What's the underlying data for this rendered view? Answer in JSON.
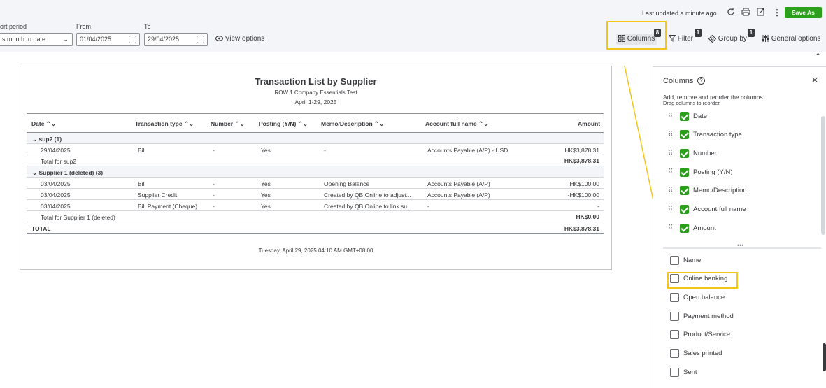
{
  "topbar": {
    "last_updated": "Last updated a minute ago",
    "save_as": "Save As",
    "report_period_label": "ort period",
    "report_period_value": "s month to date",
    "from_label": "From",
    "from_value": "01/04/2025",
    "to_label": "To",
    "to_value": "29/04/2025",
    "view_options": "View options",
    "columns_label": "Columns",
    "columns_count": "8",
    "filter_label": "Filter",
    "filter_count": "1",
    "group_by_label": "Group by",
    "group_by_count": "1",
    "general_options": "General options",
    "brand_color": "#2ca01c",
    "highlight_color": "#f5c518"
  },
  "report": {
    "title": "Transaction List by Supplier",
    "company": "ROW 1 Company Essentials Test",
    "period": "April 1-29, 2025",
    "columns": [
      "Date",
      "Transaction type",
      "Number",
      "Posting (Y/N)",
      "Memo/Description",
      "Account full name",
      "Amount"
    ],
    "groups": [
      {
        "name": "sup2 (1)",
        "rows": [
          [
            "29/04/2025",
            "Bill",
            "-",
            "Yes",
            "-",
            "Accounts Payable (A/P) - USD",
            "HK$3,878.31"
          ]
        ],
        "total_label": "Total for sup2",
        "total_value": "HK$3,878.31"
      },
      {
        "name": "Supplier 1 (deleted) (3)",
        "rows": [
          [
            "03/04/2025",
            "Bill",
            "-",
            "Yes",
            "Opening Balance",
            "Accounts Payable (A/P)",
            "HK$100.00"
          ],
          [
            "03/04/2025",
            "Supplier Credit",
            "-",
            "Yes",
            "Created by QB Online to adjust...",
            "Accounts Payable (A/P)",
            "-HK$100.00"
          ],
          [
            "03/04/2025",
            "Bill Payment (Cheque)",
            "-",
            "Yes",
            "Created by QB Online to link su...",
            "-",
            "-"
          ]
        ],
        "total_label": "Total for Supplier 1 (deleted)",
        "total_value": "HK$0.00"
      }
    ],
    "grand_total_label": "TOTAL",
    "grand_total_value": "HK$3,878.31",
    "footer": "Tuesday, April 29, 2025 04:10 AM GMT+08:00"
  },
  "panel": {
    "title": "Columns",
    "help_icon": "?",
    "desc1": "Add, remove and reorder the columns.",
    "desc2": "Drag columns to reorder.",
    "selected": [
      "Date",
      "Transaction type",
      "Number",
      "Posting (Y/N)",
      "Memo/Description",
      "Account full name",
      "Amount"
    ],
    "available": [
      "Name",
      "Online banking",
      "Open balance",
      "Payment method",
      "Product/Service",
      "Sales printed",
      "Sent"
    ]
  }
}
